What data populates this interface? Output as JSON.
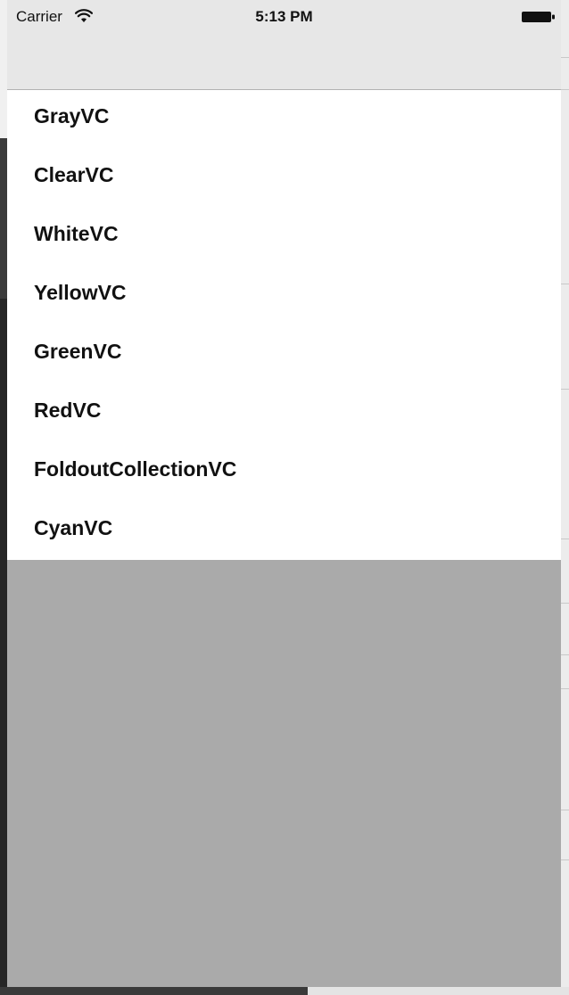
{
  "status_bar": {
    "carrier": "Carrier",
    "time": "5:13 PM"
  },
  "list": {
    "items": [
      {
        "label": "GrayVC"
      },
      {
        "label": "ClearVC"
      },
      {
        "label": "WhiteVC"
      },
      {
        "label": "YellowVC"
      },
      {
        "label": "GreenVC"
      },
      {
        "label": "RedVC"
      },
      {
        "label": "FoldoutCollectionVC"
      },
      {
        "label": "CyanVC"
      }
    ]
  },
  "colors": {
    "bar_background": "#e7e7e7",
    "list_background": "#ffffff",
    "empty_background": "#aaaaaa",
    "text": "#111111"
  }
}
